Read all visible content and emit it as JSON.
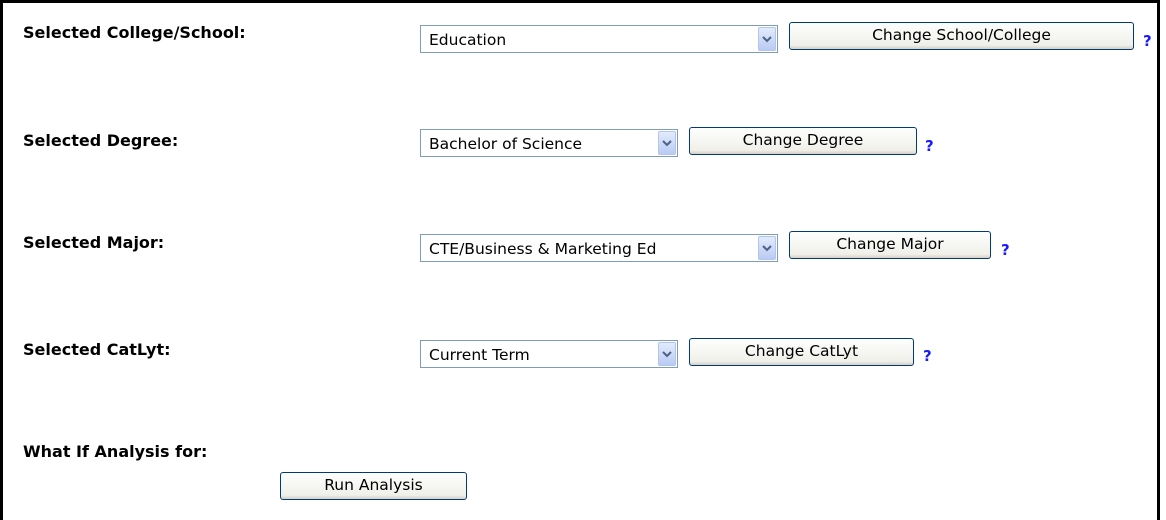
{
  "rows": {
    "college": {
      "label": "Selected College/School:",
      "value": "Education",
      "button": "Change School/College",
      "help": "?"
    },
    "degree": {
      "label": "Selected Degree:",
      "value": "Bachelor of Science",
      "button": "Change Degree",
      "help": "?"
    },
    "major": {
      "label": "Selected Major:",
      "value": "CTE/Business & Marketing Ed",
      "button": "Change Major",
      "help": "?"
    },
    "catlyt": {
      "label": "Selected CatLyt:",
      "value": "Current Term",
      "button": "Change CatLyt",
      "help": "?"
    }
  },
  "analysis": {
    "label": "What If Analysis for:",
    "button": "Run Analysis"
  },
  "colors": {
    "help": "#1a1aff",
    "select_border": "#7f9db9",
    "button_border": "#003c74"
  },
  "icons": {
    "dropdown": "chevron-down-icon"
  }
}
